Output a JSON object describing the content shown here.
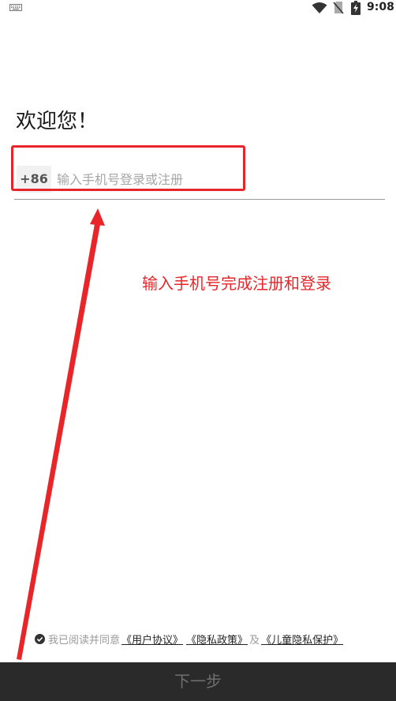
{
  "status_bar": {
    "time": "9:08",
    "icons": [
      "keyboard-icon",
      "wifi-icon",
      "no-sim-icon",
      "battery-charging-icon"
    ]
  },
  "login": {
    "title": "欢迎您！",
    "country_code": "+86",
    "phone_placeholder": "输入手机号登录或注册",
    "phone_value": ""
  },
  "annotation": {
    "text": "输入手机号完成注册和登录",
    "color": "#e8262a"
  },
  "agreement": {
    "checked": true,
    "prefix": "我已阅读并同意",
    "user_agreement": "《用户协议》",
    "privacy_policy": "《隐私政策》",
    "conjunction": "及",
    "child_privacy": "《儿童隐私保护》"
  },
  "footer": {
    "next_label": "下一步"
  },
  "colors": {
    "button_bg": "#2a2a2a",
    "button_text": "#6f6f6f",
    "accent_red": "#e8262a"
  }
}
